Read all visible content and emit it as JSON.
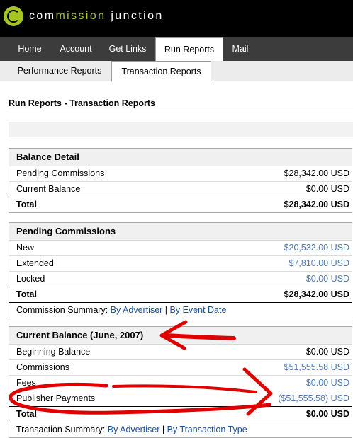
{
  "brand": {
    "name_part1": "com",
    "name_part2": "mission",
    "name_part3": " junction"
  },
  "nav": {
    "tabs": [
      "Home",
      "Account",
      "Get Links",
      "Run Reports",
      "Mail"
    ],
    "active": "Run Reports"
  },
  "subnav": {
    "tabs": [
      "Performance Reports",
      "Transaction Reports"
    ],
    "active": "Transaction Reports"
  },
  "page_title": "Run Reports - Transaction Reports",
  "balance_detail": {
    "title": "Balance Detail",
    "rows": [
      {
        "label": "Pending Commissions",
        "value": "$28,342.00 USD"
      },
      {
        "label": "Current Balance",
        "value": "$0.00 USD"
      }
    ],
    "total": {
      "label": "Total",
      "value": "$28,342.00 USD"
    }
  },
  "pending_commissions": {
    "title": "Pending Commissions",
    "rows": [
      {
        "label": "New",
        "value": "$20,532.00 USD"
      },
      {
        "label": "Extended",
        "value": "$7,810.00 USD"
      },
      {
        "label": "Locked",
        "value": "$0.00 USD"
      }
    ],
    "total": {
      "label": "Total",
      "value": "$28,342.00 USD"
    },
    "summary_label": "Commission Summary:",
    "summary_link1": "By Advertiser",
    "summary_sep": "|",
    "summary_link2": "By Event Date"
  },
  "current_balance": {
    "title": "Current Balance (June, 2007)",
    "rows": [
      {
        "label": "Beginning Balance",
        "value": "$0.00 USD"
      },
      {
        "label": "Commissions",
        "value": "$51,555.58 USD"
      },
      {
        "label": "Fees",
        "value": "$0.00 USD"
      },
      {
        "label": "Publisher Payments",
        "value": "($51,555.58) USD"
      }
    ],
    "total": {
      "label": "Total",
      "value": "$0.00 USD"
    },
    "summary_label": "Transaction Summary:",
    "summary_link1": "By Advertiser",
    "summary_sep": "|",
    "summary_link2": "By Transaction Type"
  },
  "colors": {
    "brand_green": "#a7c520",
    "nav_bg": "#3c3c3c",
    "link_blue": "#1a4fa0",
    "value_blue": "#4f79b5",
    "annotation_red": "#e00000"
  }
}
